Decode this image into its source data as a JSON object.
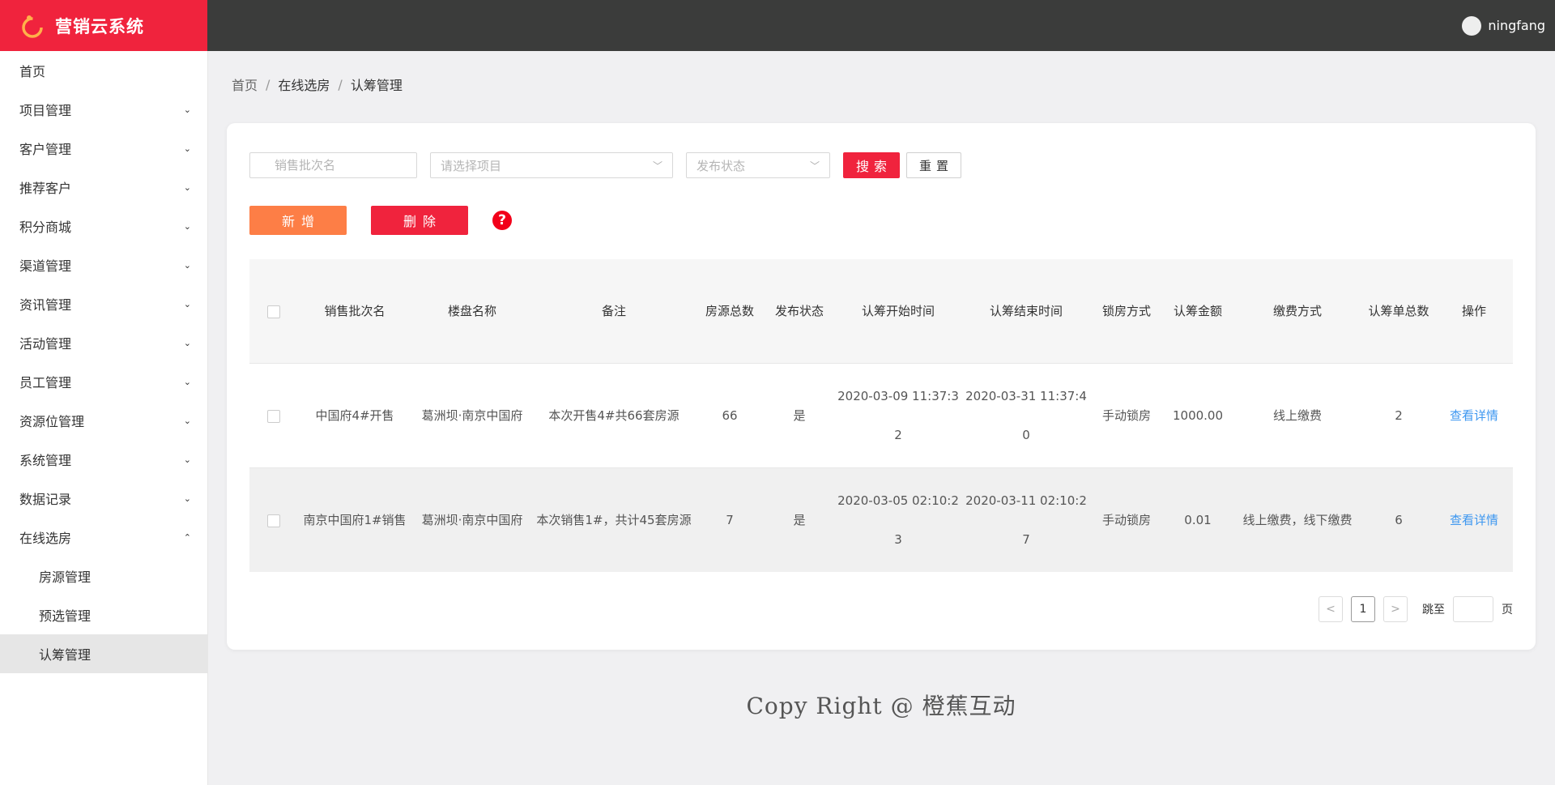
{
  "app": {
    "title": "营销云系统",
    "user": "ningfang"
  },
  "colors": {
    "brand": "#f0233d",
    "header": "#3b3c3b",
    "add": "#fd7e46",
    "link": "#3d97f0"
  },
  "sidebar": {
    "items": [
      {
        "label": "首页"
      },
      {
        "label": "项目管理"
      },
      {
        "label": "客户管理"
      },
      {
        "label": "推荐客户"
      },
      {
        "label": "积分商城"
      },
      {
        "label": "渠道管理"
      },
      {
        "label": "资讯管理"
      },
      {
        "label": "活动管理"
      },
      {
        "label": "员工管理"
      },
      {
        "label": "资源位管理"
      },
      {
        "label": "系统管理"
      },
      {
        "label": "数据记录"
      },
      {
        "label": "在线选房"
      }
    ],
    "sub": [
      {
        "label": "房源管理"
      },
      {
        "label": "预选管理"
      },
      {
        "label": "认筹管理"
      }
    ]
  },
  "breadcrumb": {
    "home": "首页",
    "parent": "在线选房",
    "current": "认筹管理",
    "sep": "/"
  },
  "filters": {
    "batch_placeholder": "销售批次名",
    "project_placeholder": "请选择项目",
    "status_placeholder": "发布状态",
    "search_label": "搜索",
    "reset_label": "重置"
  },
  "actions": {
    "add_label": "新增",
    "delete_label": "删除",
    "help": "?"
  },
  "table": {
    "headers": [
      "销售批次名",
      "楼盘名称",
      "备注",
      "房源总数",
      "发布状态",
      "认筹开始时间",
      "认筹结束时间",
      "锁房方式",
      "认筹金额",
      "缴费方式",
      "认筹单总数",
      "操作"
    ],
    "rows": [
      {
        "batch": "中国府4#开售",
        "estate": "葛洲坝·南京中国府",
        "remark": "本次开售4#共66套房源",
        "total": "66",
        "published": "是",
        "start": "2020-03-09 11:37:32",
        "end": "2020-03-31 11:37:40",
        "lock": "手动锁房",
        "amount": "1000.00",
        "payment": "线上缴费",
        "count": "2",
        "op": "查看详情"
      },
      {
        "batch": "南京中国府1#销售",
        "estate": "葛洲坝·南京中国府",
        "remark": "本次销售1#，共计45套房源",
        "total": "7",
        "published": "是",
        "start": "2020-03-05 02:10:23",
        "end": "2020-03-11 02:10:27",
        "lock": "手动锁房",
        "amount": "0.01",
        "payment": "线上缴费，线下缴费",
        "count": "6",
        "op": "查看详情"
      }
    ]
  },
  "pagination": {
    "prev": "<",
    "page": "1",
    "next": ">",
    "jump_label": "跳至",
    "page_unit": "页"
  },
  "footer": {
    "text": "Copy Right @ 橙蕉互动"
  }
}
